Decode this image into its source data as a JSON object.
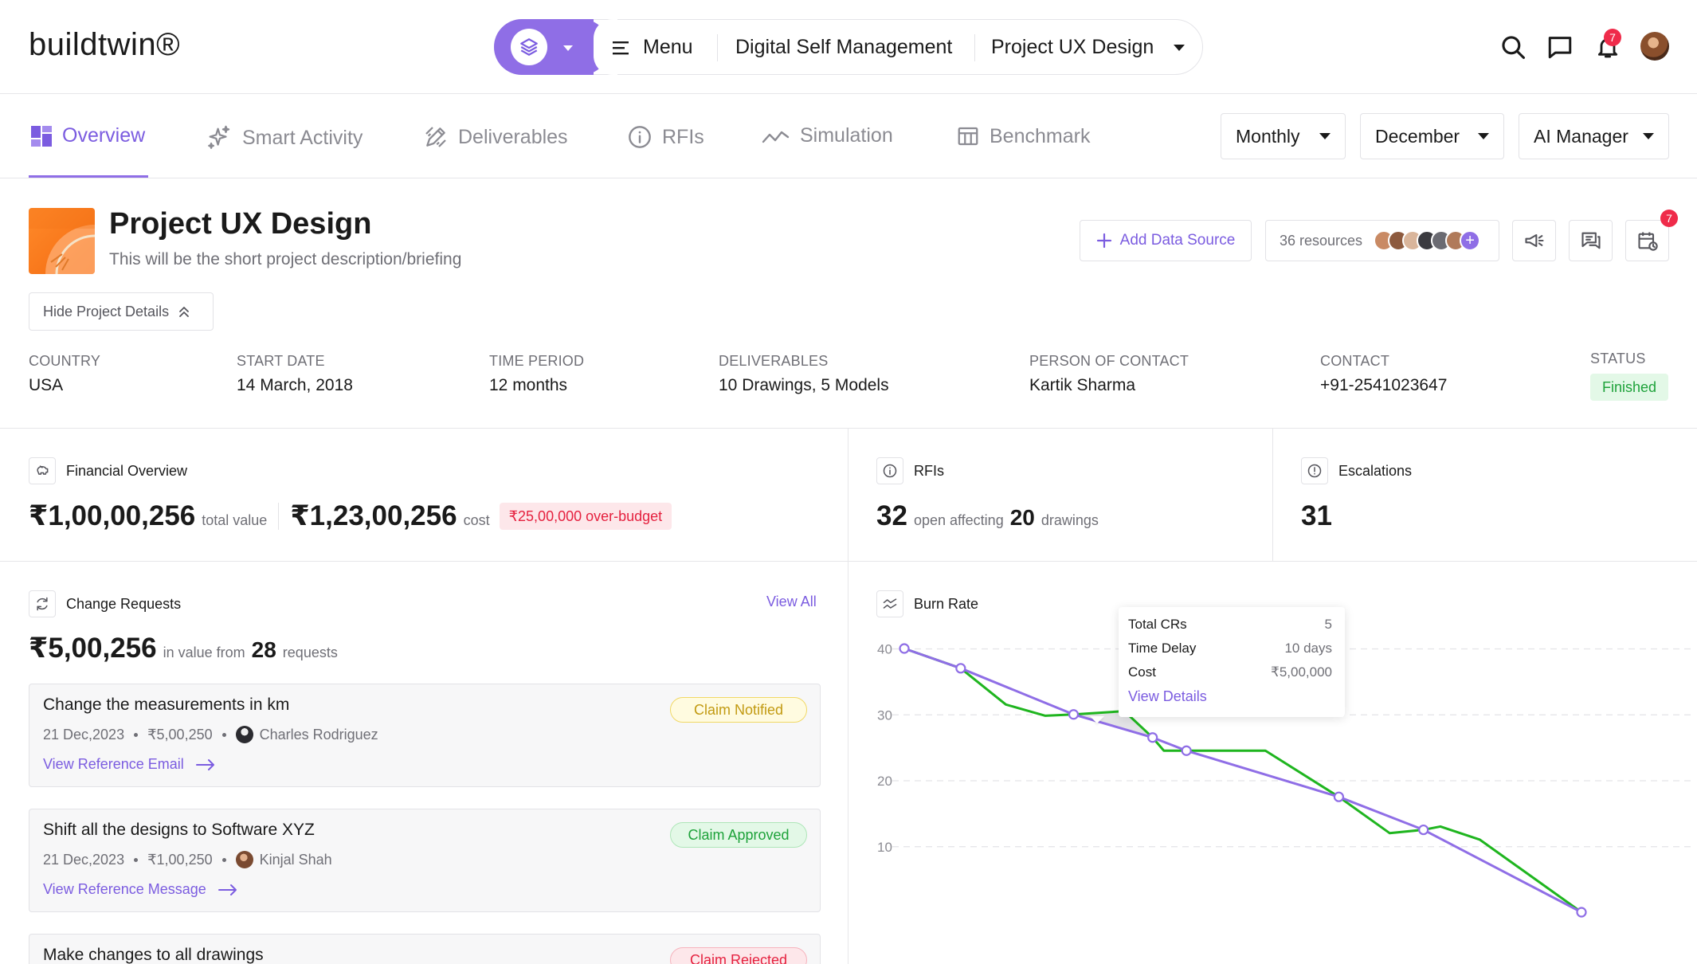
{
  "app": {
    "logo": "buildtwin®"
  },
  "switcher": {
    "menu_label": "Menu",
    "workspace": "Digital Self Management",
    "project": "Project UX Design"
  },
  "header_icons": {
    "search": "search-icon",
    "chat": "chat-icon",
    "bell": "bell-icon",
    "notifications_count": "7"
  },
  "tabs": [
    {
      "label": "Overview",
      "icon": "overview-icon",
      "active": true
    },
    {
      "label": "Smart Activity",
      "icon": "sparkle-icon"
    },
    {
      "label": "Deliverables",
      "icon": "pen-ruler-icon"
    },
    {
      "label": "RFIs",
      "icon": "info-icon"
    },
    {
      "label": "Simulation",
      "icon": "trend-icon"
    },
    {
      "label": "Benchmark",
      "icon": "table-icon"
    }
  ],
  "filters": {
    "period": "Monthly",
    "month": "December",
    "manager": "AI Manager"
  },
  "project": {
    "title": "Project UX Design",
    "description": "This will be the short project description/briefing",
    "hide_details": "Hide Project Details",
    "add_data_source": "Add Data Source",
    "resources": "36 resources",
    "calendar_badge": "7"
  },
  "meta": [
    {
      "label": "COUNTRY",
      "value": "USA"
    },
    {
      "label": "START DATE",
      "value": "14 March, 2018"
    },
    {
      "label": "TIME PERIOD",
      "value": "12 months"
    },
    {
      "label": "DELIVERABLES",
      "value": "10 Drawings, 5 Models"
    },
    {
      "label": "PERSON OF CONTACT",
      "value": "Kartik Sharma"
    },
    {
      "label": "CONTACT",
      "value": "+91-2541023647"
    },
    {
      "label": "STATUS",
      "value": "Finished"
    }
  ],
  "financial": {
    "title": "Financial Overview",
    "total_value": "₹1,00,00,256",
    "total_value_label": "total value",
    "cost": "₹1,23,00,256",
    "cost_label": "cost",
    "over_budget": "₹25,00,000 over-budget"
  },
  "rfis": {
    "title": "RFIs",
    "open": "32",
    "open_label": "open affecting",
    "drawings": "20",
    "drawings_label": "drawings"
  },
  "escalations": {
    "title": "Escalations",
    "count": "31"
  },
  "change_requests": {
    "title": "Change Requests",
    "view_all": "View All",
    "value": "₹5,00,256",
    "value_label": "in value from",
    "count": "28",
    "count_label": "requests",
    "items": [
      {
        "title": "Change the measurements in km",
        "date": "21 Dec,2023",
        "amount": "₹5,00,250",
        "person": "Charles Rodriguez",
        "link": "View Reference Email",
        "status": "Claim Notified"
      },
      {
        "title": "Shift all the designs to Software XYZ",
        "date": "21 Dec,2023",
        "amount": "₹1,00,250",
        "person": "Kinjal Shah",
        "link": "View Reference Message",
        "status": "Claim Approved"
      },
      {
        "title": "Make changes to all drawings",
        "status": "Claim Rejected"
      }
    ]
  },
  "burn_rate": {
    "title": "Burn Rate",
    "tooltip": {
      "total_crs_label": "Total CRs",
      "total_crs": "5",
      "time_delay_label": "Time Delay",
      "time_delay": "10 days",
      "cost_label": "Cost",
      "cost": "₹5,00,000",
      "link": "View Details"
    }
  },
  "chart_data": {
    "type": "line",
    "title": "Burn Rate",
    "y_ticks": [
      "40",
      "30",
      "20",
      "10"
    ],
    "ylim": [
      0,
      40
    ],
    "grid": true,
    "series": [
      {
        "color": "#8f6ee6",
        "marker": "circle",
        "points": [
          [
            0,
            40
          ],
          [
            1,
            37
          ],
          [
            3,
            30
          ],
          [
            4.4,
            26.5
          ],
          [
            5,
            24.5
          ],
          [
            7.7,
            17.5
          ],
          [
            9.2,
            12.5
          ],
          [
            12,
            0
          ]
        ]
      },
      {
        "color": "#1fb51f",
        "points": [
          [
            0,
            40
          ],
          [
            1,
            37
          ],
          [
            1.8,
            31.5
          ],
          [
            2.5,
            29.8
          ],
          [
            3,
            30
          ],
          [
            3.9,
            30.5
          ],
          [
            4.4,
            26.5
          ],
          [
            4.6,
            24.5
          ],
          [
            5,
            24.5
          ],
          [
            6.4,
            24.5
          ],
          [
            7.7,
            17.5
          ],
          [
            8.6,
            12
          ],
          [
            9.2,
            12.5
          ],
          [
            9.5,
            13
          ],
          [
            10.2,
            11
          ],
          [
            12,
            0
          ]
        ]
      }
    ],
    "highlight_point_index": 4
  }
}
